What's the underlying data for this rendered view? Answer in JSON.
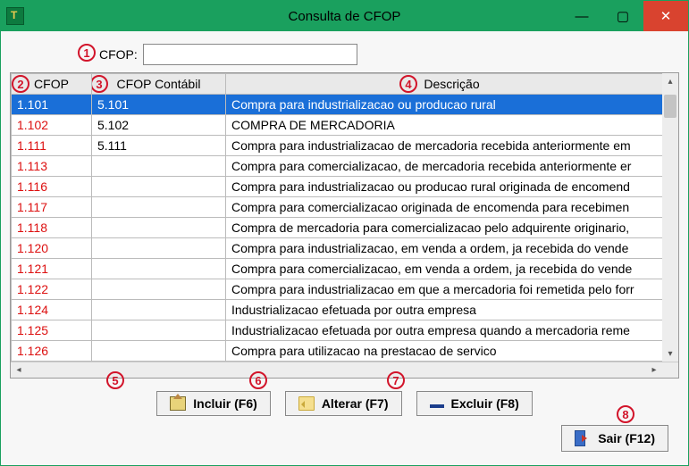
{
  "window": {
    "title": "Consulta de CFOP"
  },
  "filter": {
    "label": "CFOP:",
    "value": ""
  },
  "columns": {
    "cfop": "CFOP",
    "contabil": "CFOP Contábil",
    "descricao": "Descrição"
  },
  "markers": {
    "m1": "1",
    "m2": "2",
    "m3": "3",
    "m4": "4",
    "m5": "5",
    "m6": "6",
    "m7": "7",
    "m8": "8"
  },
  "rows": [
    {
      "cfop": "1.101",
      "contabil": "5.101",
      "desc": "Compra para industrializacao ou producao rural",
      "selected": true
    },
    {
      "cfop": "1.102",
      "contabil": "5.102",
      "desc": "COMPRA DE MERCADORIA"
    },
    {
      "cfop": "1.111",
      "contabil": "5.111",
      "desc": "Compra para industrializacao de mercadoria recebida anteriormente em"
    },
    {
      "cfop": "1.113",
      "contabil": "",
      "desc": "Compra para comercializacao, de mercadoria recebida anteriormente er"
    },
    {
      "cfop": "1.116",
      "contabil": "",
      "desc": "Compra para industrializacao ou producao rural originada de encomend"
    },
    {
      "cfop": "1.117",
      "contabil": "",
      "desc": "Compra para comercializacao originada de encomenda para recebimen"
    },
    {
      "cfop": "1.118",
      "contabil": "",
      "desc": "Compra de mercadoria para comercializacao pelo adquirente originario,"
    },
    {
      "cfop": "1.120",
      "contabil": "",
      "desc": "Compra para industrializacao, em venda a ordem, ja recebida do vende"
    },
    {
      "cfop": "1.121",
      "contabil": "",
      "desc": "Compra para comercializacao, em venda a ordem, ja recebida do vende"
    },
    {
      "cfop": "1.122",
      "contabil": "",
      "desc": "Compra para industrializacao em que a mercadoria foi remetida pelo forr"
    },
    {
      "cfop": "1.124",
      "contabil": "",
      "desc": "Industrializacao efetuada por outra empresa"
    },
    {
      "cfop": "1.125",
      "contabil": "",
      "desc": "Industrializacao efetuada por outra empresa quando a mercadoria reme"
    },
    {
      "cfop": "1.126",
      "contabil": "",
      "desc": "Compra para utilizacao na prestacao de servico"
    }
  ],
  "buttons": {
    "incluir": "Incluir (F6)",
    "alterar": "Alterar (F7)",
    "excluir": "Excluir (F8)",
    "sair": "Sair (F12)"
  }
}
